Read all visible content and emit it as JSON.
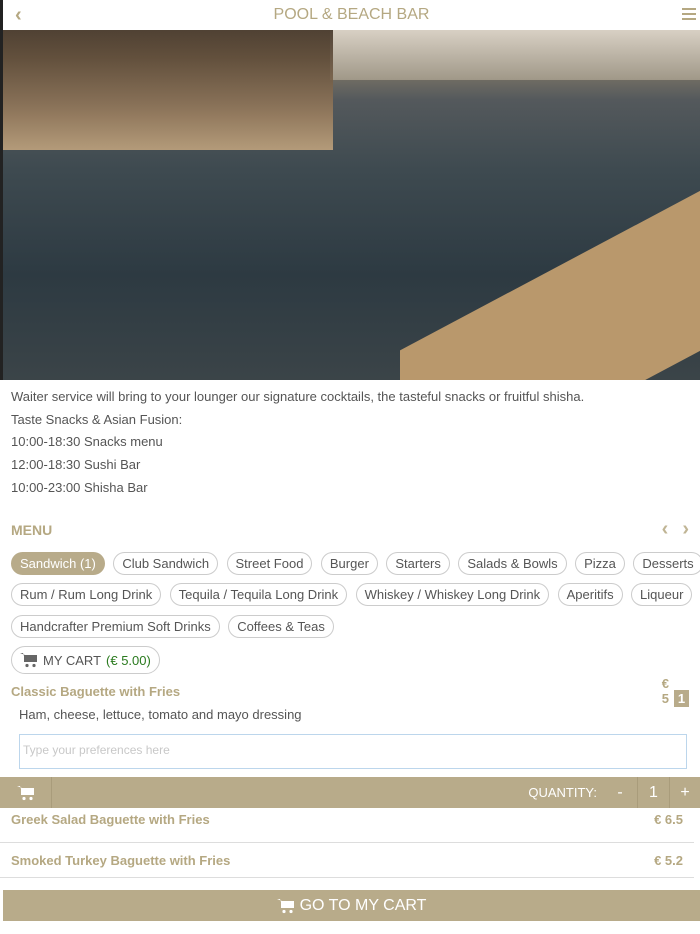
{
  "header": {
    "title": "POOL & BEACH BAR",
    "back": "‹"
  },
  "description": [
    "Waiter service will bring to your lounger our signature cocktails, the tasteful snacks or fruitful shisha.",
    "Taste Snacks & Asian Fusion:",
    "10:00-18:30 Snacks menu",
    "12:00-18:30 Sushi Bar",
    "10:00-23:00 Shisha Bar"
  ],
  "menu": {
    "title": "MENU",
    "prev": "‹",
    "next": "›"
  },
  "categories": [
    [
      "Sandwich (1)",
      "Club Sandwich",
      "Street Food",
      "Burger",
      "Starters",
      "Salads & Bowls",
      "Pizza",
      "Desserts"
    ],
    [
      "Rum / Rum Long Drink",
      "Tequila / Tequila Long Drink",
      "Whiskey / Whiskey Long Drink",
      "Aperitifs",
      "Liqueur"
    ],
    [
      "Handcrafter Premium Soft Drinks",
      "Coffees & Teas"
    ]
  ],
  "cart": {
    "label": "MY CART",
    "total": "(€ 5.00)"
  },
  "items": [
    {
      "name": "Classic Baguette with Fries",
      "price": "€ 5",
      "qty_badge": "1",
      "description": "Ham, cheese, lettuce, tomato and mayo dressing",
      "placeholder": "Type your preferences here",
      "quantity_label": "QUANTITY:",
      "minus": "-",
      "quantity": "1",
      "plus": "+"
    },
    {
      "name": "Greek Salad Baguette with Fries",
      "price": "€ 6.5"
    },
    {
      "name": "Smoked Turkey Baguette with Fries",
      "price": "€ 5.2"
    }
  ],
  "goto_cart": "GO TO MY CART",
  "colors": {
    "accent": "#b8ab8a",
    "cart_total": "#2a7a1e"
  }
}
